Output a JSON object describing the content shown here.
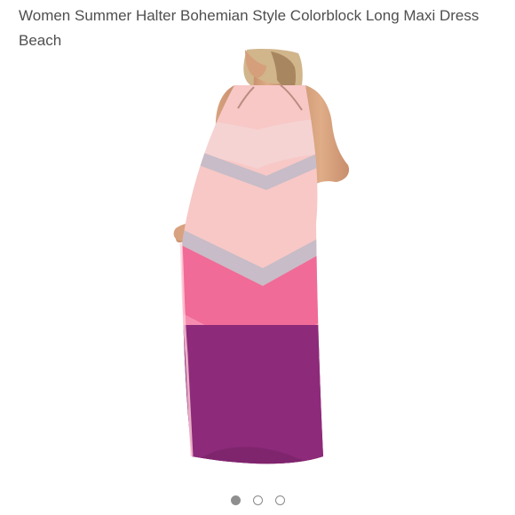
{
  "product": {
    "title": "Women Summer Halter Bohemian Style Colorblock Long Maxi Dress Beach",
    "image_subject": "woman-in-colorblock-maxi-dress",
    "colors": {
      "blush": "#f7c8c6",
      "pink": "#f06b97",
      "magenta": "#8d2a7a",
      "gray_stripe": "#c7bcc7",
      "skin": "#d7a27d",
      "hair": "#d1b58b"
    }
  },
  "carousel": {
    "total_slides": 3,
    "active_slide": 1,
    "dots": [
      {
        "label": "",
        "active": true
      },
      {
        "label": "",
        "active": false
      },
      {
        "label": "",
        "active": false
      }
    ]
  }
}
